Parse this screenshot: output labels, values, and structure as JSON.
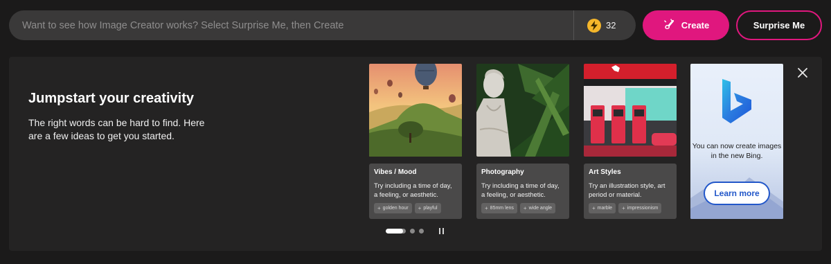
{
  "prompt": {
    "placeholder": "Want to see how Image Creator works? Select Surprise Me, then Create"
  },
  "boosts": {
    "count": "32",
    "icon": "lightning-bolt-icon"
  },
  "buttons": {
    "create": "Create",
    "surprise": "Surprise Me"
  },
  "panel": {
    "title": "Jumpstart your creativity",
    "description": "The right words can be hard to find. Here are a few ideas to get you started."
  },
  "cards": [
    {
      "title": "Vibes / Mood",
      "text": "Try including a time of day, a feeling, or aesthetic.",
      "chips": [
        "golden hour",
        "playful"
      ]
    },
    {
      "title": "Photography",
      "text": "Try including a time of day, a feeling, or aesthetic.",
      "chips": [
        "85mm lens",
        "wide angle"
      ]
    },
    {
      "title": "Art Styles",
      "text": "Try an illustration style, art period or material.",
      "chips": [
        "marble",
        "impressionism"
      ]
    }
  ],
  "bing_promo": {
    "text": "You can now create images in the new Bing.",
    "button": "Learn more"
  },
  "carousel": {
    "pages": 3,
    "active_page": 1,
    "progress": 0.85
  },
  "colors": {
    "accent": "#e0177e",
    "boost": "#f5b62a",
    "bing_blue": "#2257c9"
  }
}
